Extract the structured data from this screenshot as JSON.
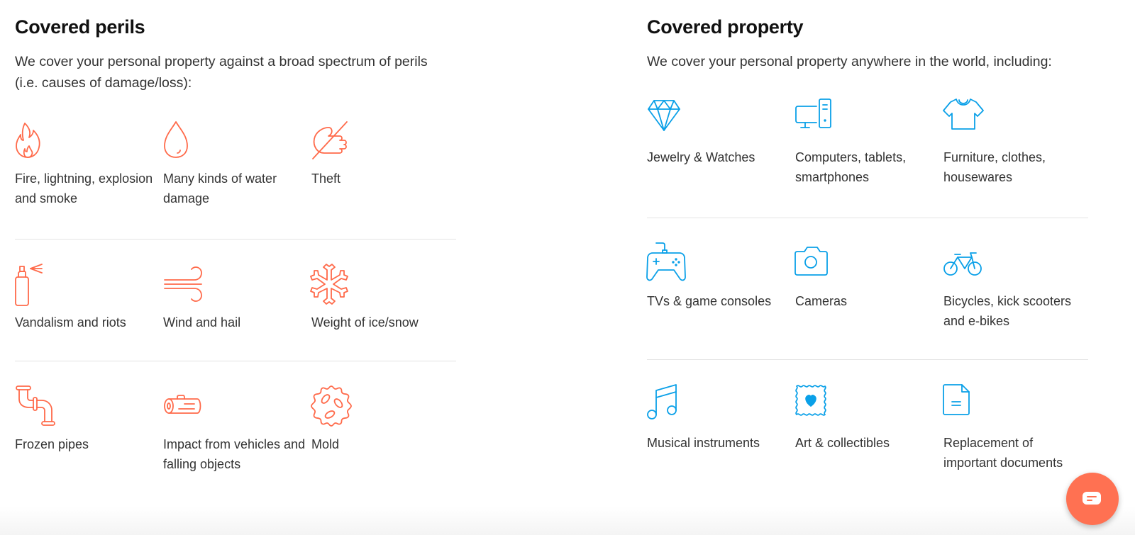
{
  "colors": {
    "perils_icon": "#ff6a4a",
    "property_icon": "#0aa0e8",
    "chat_button": "#ff7152"
  },
  "perils": {
    "title": "Covered perils",
    "description": "We cover your personal property against a broad spectrum of perils (i.e. causes of damage/loss):",
    "rows": [
      [
        {
          "icon": "fire-icon",
          "label": "Fire, lightning, explosion and smoke"
        },
        {
          "icon": "water-drop-icon",
          "label": "Many kinds of water damage"
        },
        {
          "icon": "theft-hand-icon",
          "label": "Theft"
        }
      ],
      [
        {
          "icon": "spray-can-icon",
          "label": "Vandalism and riots"
        },
        {
          "icon": "wind-icon",
          "label": "Wind and hail"
        },
        {
          "icon": "snowflake-icon",
          "label": "Weight of ice/snow"
        }
      ],
      [
        {
          "icon": "pipe-icon",
          "label": "Frozen pipes"
        },
        {
          "icon": "log-icon",
          "label": "Impact from vehicles and falling objects"
        },
        {
          "icon": "mold-icon",
          "label": "Mold"
        }
      ]
    ]
  },
  "property": {
    "title": "Covered property",
    "description": "We cover your personal property anywhere in the world, including:",
    "rows": [
      [
        {
          "icon": "diamond-icon",
          "label": "Jewelry & Watches"
        },
        {
          "icon": "computer-icon",
          "label": "Computers, tablets, smartphones"
        },
        {
          "icon": "tshirt-icon",
          "label": "Furniture, clothes, housewares"
        }
      ],
      [
        {
          "icon": "gamepad-icon",
          "label": "TVs & game consoles"
        },
        {
          "icon": "camera-icon",
          "label": "Cameras"
        },
        {
          "icon": "bicycle-icon",
          "label": "Bicycles, kick scooters and e-bikes"
        }
      ],
      [
        {
          "icon": "music-note-icon",
          "label": "Musical instruments"
        },
        {
          "icon": "stamp-heart-icon",
          "label": "Art & collectibles"
        },
        {
          "icon": "document-icon",
          "label": "Replacement of important documents"
        }
      ]
    ]
  },
  "chat": {
    "icon": "chat-bubble-icon",
    "aria_label": "Chat"
  }
}
